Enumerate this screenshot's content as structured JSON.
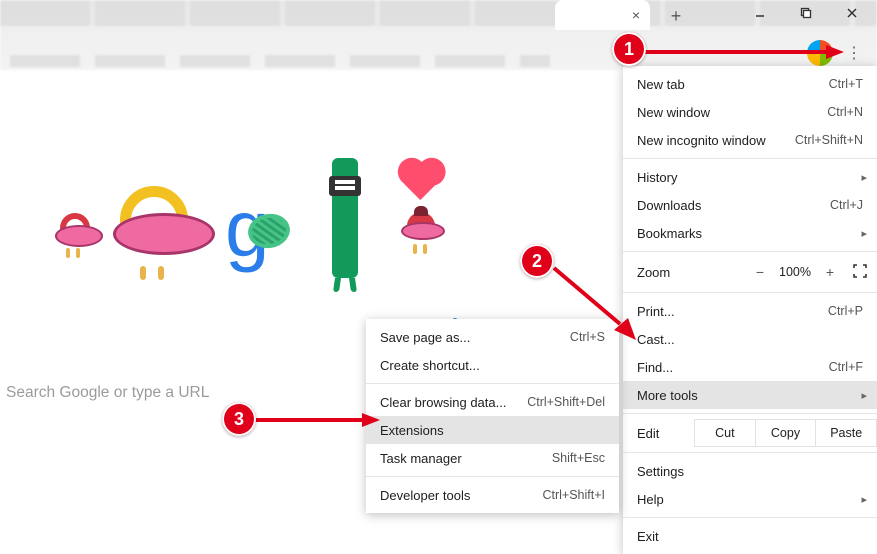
{
  "search_placeholder": "Search Google or type a URL",
  "window_controls": {
    "min": "minimize",
    "max": "maximize",
    "close": "close"
  },
  "newtab_plus": "+",
  "close_x": "×",
  "main_menu": {
    "newtab": {
      "label": "New tab",
      "shortcut": "Ctrl+T"
    },
    "newwin": {
      "label": "New window",
      "shortcut": "Ctrl+N"
    },
    "newincog": {
      "label": "New incognito window",
      "shortcut": "Ctrl+Shift+N"
    },
    "history": {
      "label": "History"
    },
    "downloads": {
      "label": "Downloads",
      "shortcut": "Ctrl+J"
    },
    "bookmarks": {
      "label": "Bookmarks"
    },
    "zoom_label": "Zoom",
    "zoom_value": "100%",
    "zoom_minus": "−",
    "zoom_plus": "+",
    "print": {
      "label": "Print...",
      "shortcut": "Ctrl+P"
    },
    "cast": {
      "label": "Cast..."
    },
    "find": {
      "label": "Find...",
      "shortcut": "Ctrl+F"
    },
    "moretools": {
      "label": "More tools"
    },
    "edit_label": "Edit",
    "edit_cut": "Cut",
    "edit_copy": "Copy",
    "edit_paste": "Paste",
    "settings": {
      "label": "Settings"
    },
    "help": {
      "label": "Help"
    },
    "exit": {
      "label": "Exit"
    }
  },
  "sub_menu": {
    "savepage": {
      "label": "Save page as...",
      "shortcut": "Ctrl+S"
    },
    "shortcut": {
      "label": "Create shortcut..."
    },
    "clear": {
      "label": "Clear browsing data...",
      "shortcut": "Ctrl+Shift+Del"
    },
    "extensions": {
      "label": "Extensions"
    },
    "taskmgr": {
      "label": "Task manager",
      "shortcut": "Shift+Esc"
    },
    "devtools": {
      "label": "Developer tools",
      "shortcut": "Ctrl+Shift+I"
    }
  },
  "markers": {
    "m1": "1",
    "m2": "2",
    "m3": "3"
  }
}
